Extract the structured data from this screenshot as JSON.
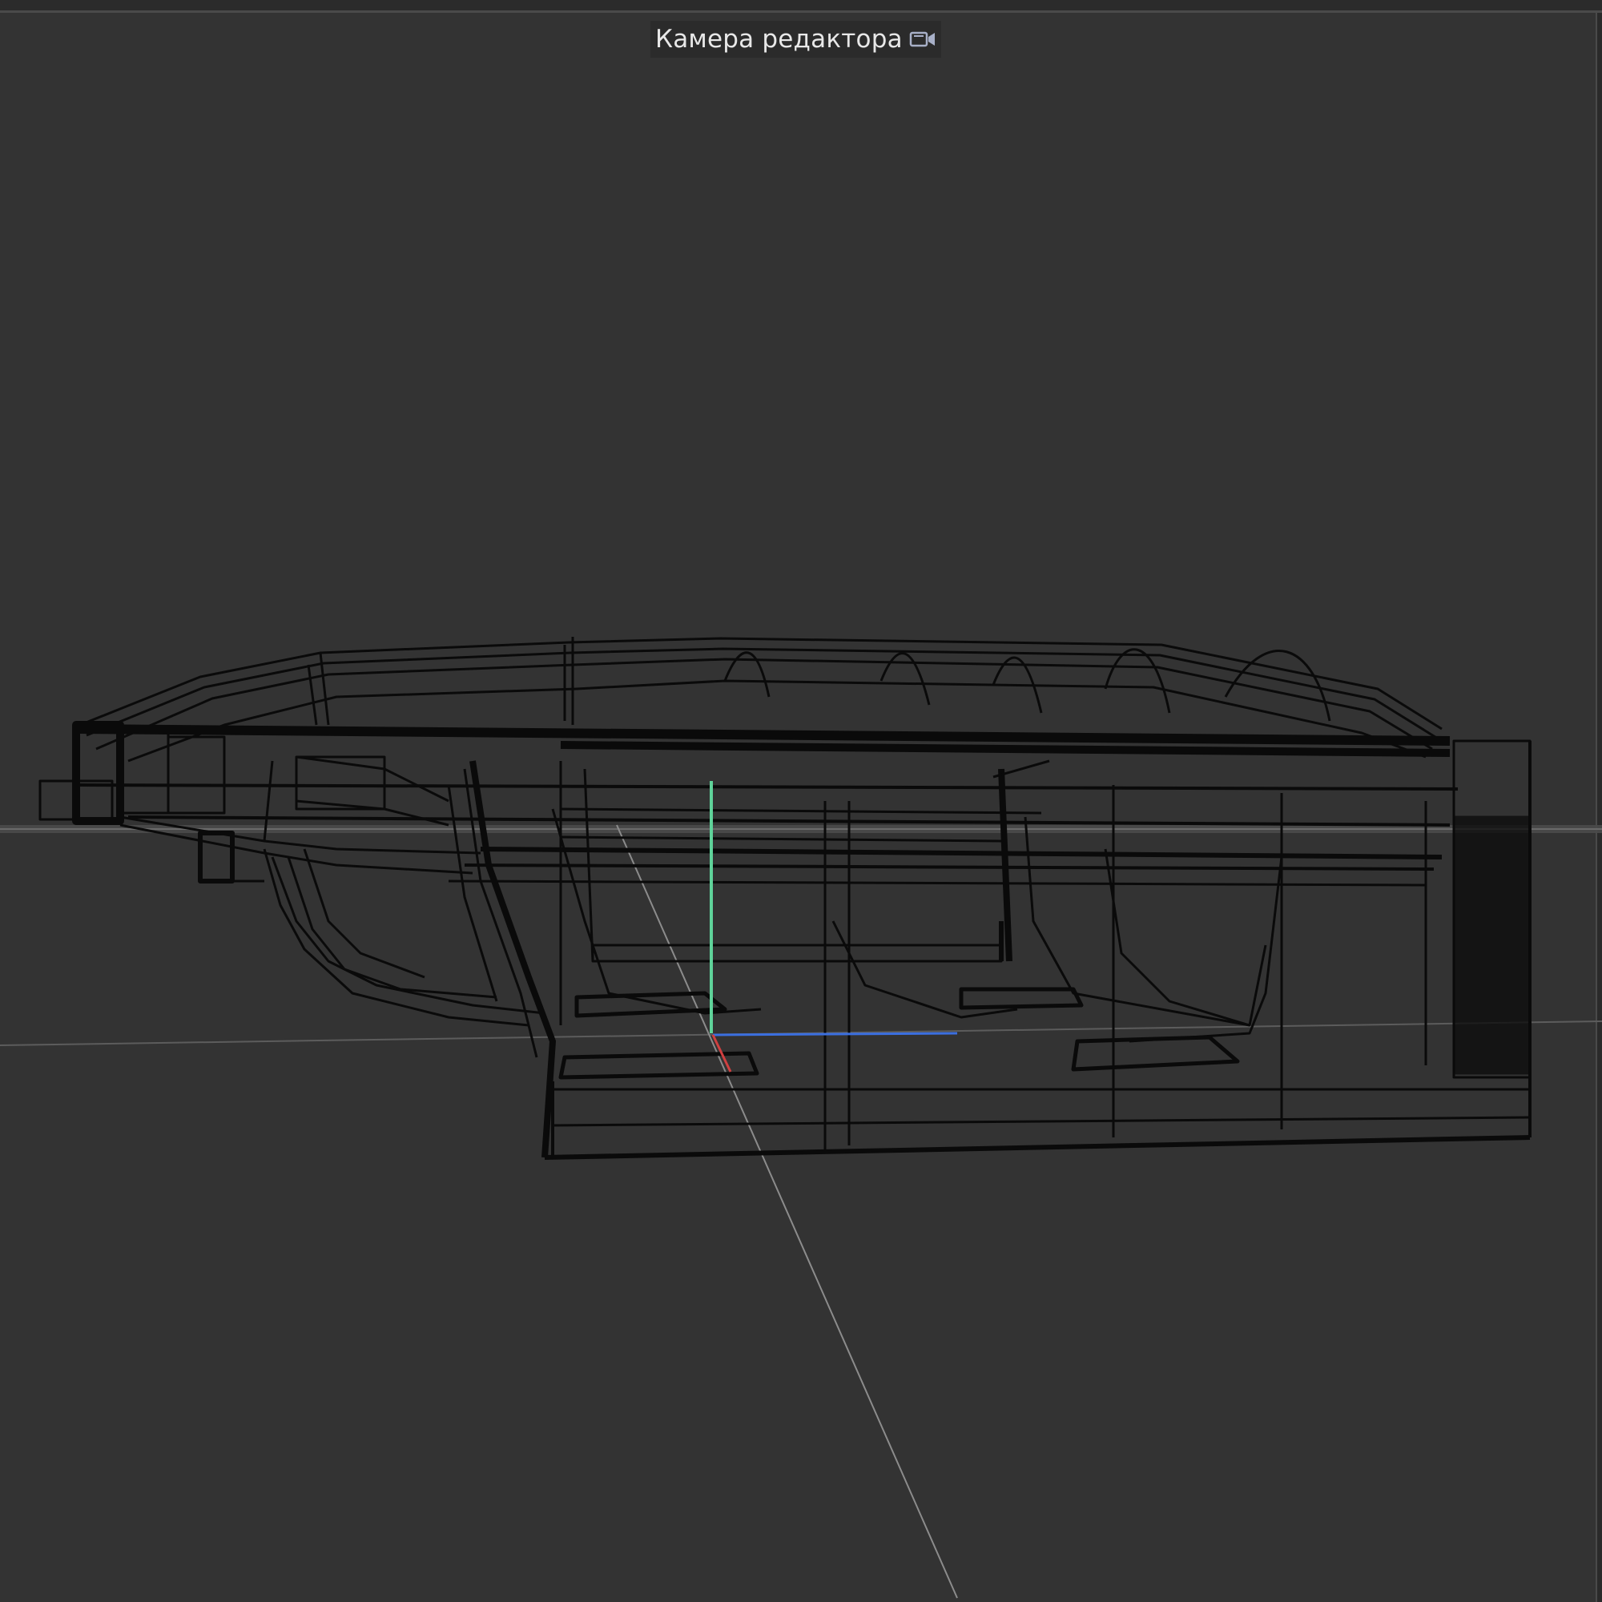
{
  "viewport": {
    "camera_label": "Камера редактора",
    "camera_icon": "camera-icon",
    "background_color": "#333333"
  },
  "scene": {
    "axis_colors": {
      "x": "#d04040",
      "y": "#5fd39a",
      "z": "#3b6fe0",
      "grid": "#9a9a9a"
    },
    "wire_color": "#0a0a0a"
  }
}
